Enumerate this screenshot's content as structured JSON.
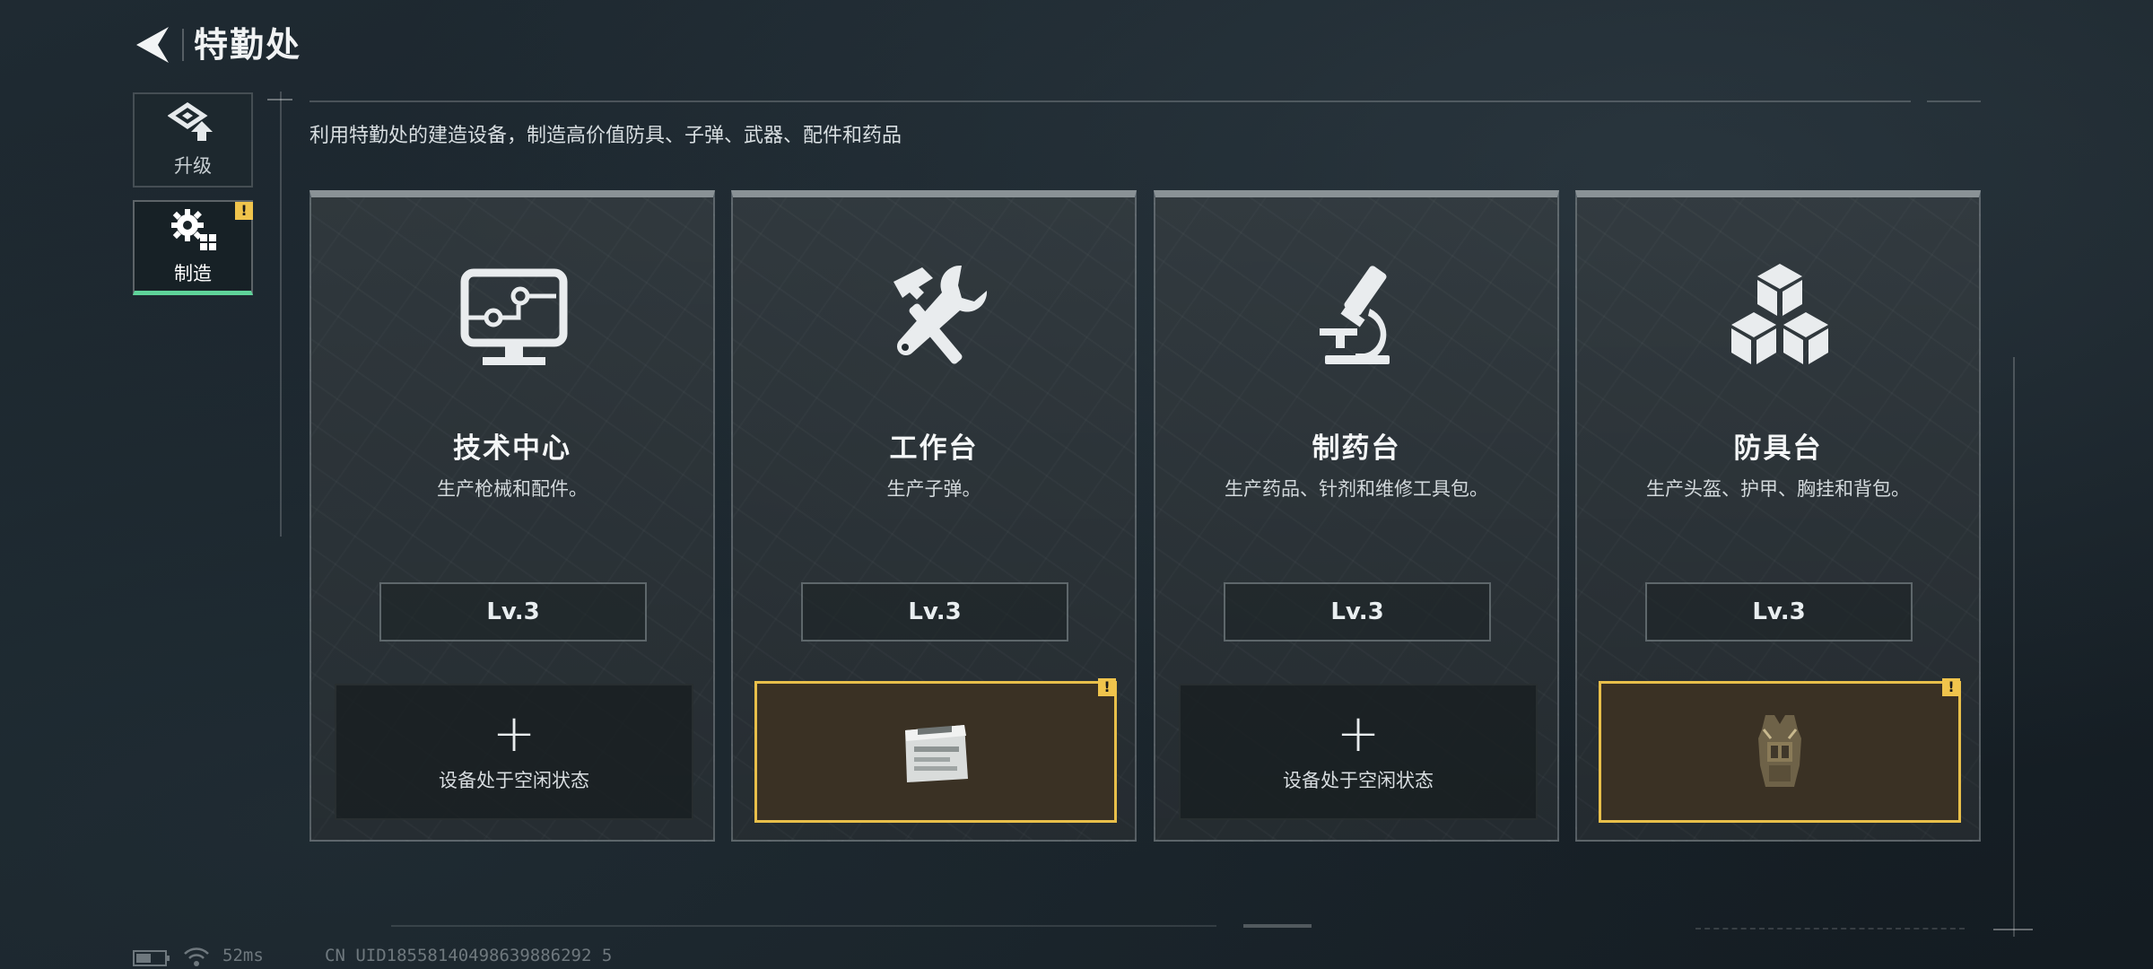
{
  "header": {
    "title": "特勤处"
  },
  "side_tabs": [
    {
      "label": "升级",
      "icon": "upgrade-icon"
    },
    {
      "label": "制造",
      "icon": "gear-build-icon",
      "badge": "!"
    }
  ],
  "subtitle": "利用特勤处的建造设备，制造高价值防具、子弹、武器、配件和药品",
  "cards": [
    {
      "name": "技术中心",
      "desc": "生产枪械和配件。",
      "level": "Lv.3",
      "icon": "monitor-circuit-icon",
      "slot": {
        "state": "idle",
        "plus": "+",
        "text": "设备处于空闲状态"
      }
    },
    {
      "name": "工作台",
      "desc": "生产子弹。",
      "level": "Lv.3",
      "icon": "hammer-wrench-icon",
      "slot": {
        "state": "active",
        "badge": "!",
        "item": "ammo-box-icon"
      }
    },
    {
      "name": "制药台",
      "desc": "生产药品、针剂和维修工具包。",
      "level": "Lv.3",
      "icon": "microscope-icon",
      "slot": {
        "state": "idle",
        "plus": "+",
        "text": "设备处于空闲状态"
      }
    },
    {
      "name": "防具台",
      "desc": "生产头盔、护甲、胸挂和背包。",
      "level": "Lv.3",
      "icon": "cubes-icon",
      "slot": {
        "state": "active",
        "badge": "!",
        "item": "armor-vest-icon"
      }
    }
  ],
  "status_bar": {
    "ping": "52ms",
    "uid": "CN UID18558140498639886292 5"
  },
  "colors": {
    "accent_green": "#5fd39a",
    "alert_yellow": "#f0c44c",
    "slot_border": "#e8bf4a"
  }
}
